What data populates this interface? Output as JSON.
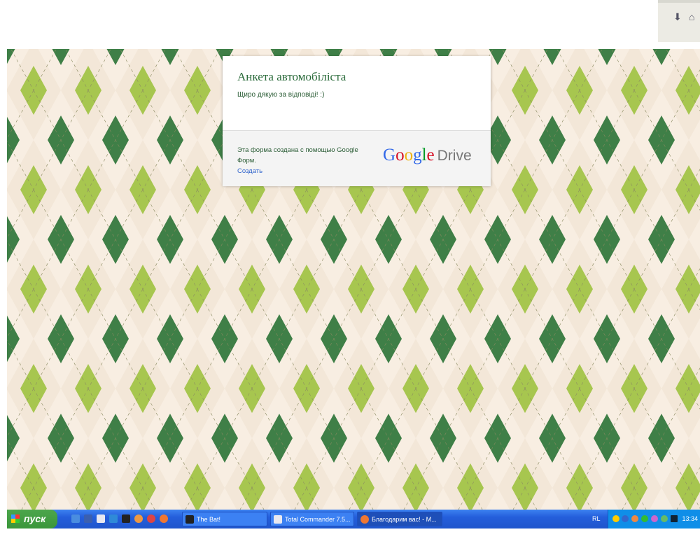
{
  "browser": {
    "nav_icons": [
      "download-arrow-icon",
      "home-icon"
    ]
  },
  "form": {
    "title": "Анкета автомобіліста",
    "message": "Щиро дякую за відповіді!  :)",
    "footer_text": "Эта форма создана с помощью Google Форм.",
    "create_link": "Создать",
    "logo_google": "Google",
    "logo_drive": "Drive"
  },
  "colors": {
    "dark_diamond": "#3f7f47",
    "light_diamond": "#a7c64f",
    "background": "#f3e7d8",
    "title": "#2b6b3b",
    "link": "#3366cc"
  },
  "taskbar": {
    "start_label": "пуск",
    "tasks": [
      {
        "label": "The Bat!",
        "active": false
      },
      {
        "label": "Total Commander 7.5...",
        "active": false
      },
      {
        "label": "Благодарим вас! - M...",
        "active": true
      }
    ],
    "language": "RL",
    "clock": "13:34"
  }
}
